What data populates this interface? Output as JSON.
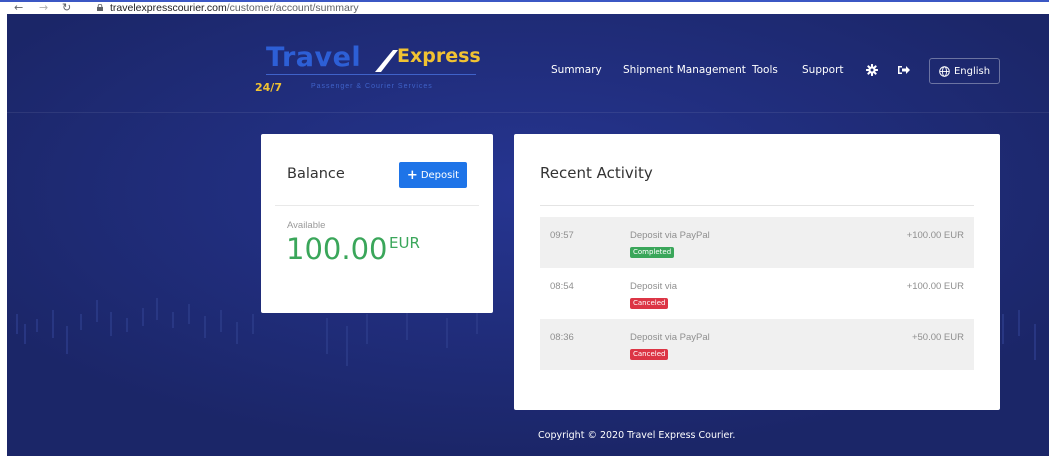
{
  "browser": {
    "back_icon": "arrow-left-icon",
    "forward_icon": "arrow-right-icon",
    "reload_icon": "reload-icon",
    "url_host": "travelexpresscourier.com",
    "url_path": "/customer/account/summary"
  },
  "brand": {
    "name_part1": "Travel",
    "name_part2": "Express",
    "hours": "24/7",
    "tagline": "Passenger & Courier Services"
  },
  "nav": {
    "items": [
      {
        "label": "Summary"
      },
      {
        "label": "Shipment Management"
      },
      {
        "label": "Tools"
      },
      {
        "label": "Support"
      }
    ],
    "settings_icon": "gear-icon",
    "logout_icon": "sign-out-icon",
    "language_label": "English",
    "language_icon": "globe-icon"
  },
  "balance": {
    "title": "Balance",
    "deposit_label": "Deposit",
    "available_label": "Available",
    "amount": "100.00",
    "currency": "EUR"
  },
  "activity": {
    "title": "Recent Activity",
    "rows": [
      {
        "time": "09:57",
        "description": "Deposit via PayPal",
        "status": "Completed",
        "amount": "+100.00 EUR"
      },
      {
        "time": "08:54",
        "description": "Deposit via",
        "status": "Canceled",
        "amount": "+100.00 EUR"
      },
      {
        "time": "08:36",
        "description": "Deposit via PayPal",
        "status": "Canceled",
        "amount": "+50.00 EUR"
      }
    ]
  },
  "colors": {
    "background": "#1d2a72",
    "accent": "#1e74e8",
    "completed": "#3aa65a",
    "canceled": "#dc3545",
    "brand_yellow": "#f1c232"
  },
  "footer": {
    "text": "Copyright © 2020 Travel Express Courier."
  }
}
